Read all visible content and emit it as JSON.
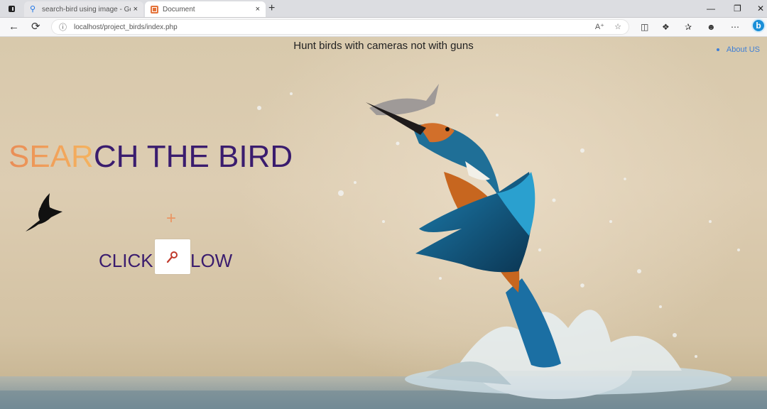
{
  "browser": {
    "tabs": [
      {
        "title": "search-bird using image - Google",
        "active": false
      },
      {
        "title": "Document",
        "active": true
      }
    ],
    "new_tab": "+",
    "close": "×",
    "address": "localhost/project_birds/index.php"
  },
  "page": {
    "tagline": "Hunt birds with cameras not with guns",
    "about_link": "About US",
    "headline_accent": "SEAR",
    "headline_rest": "CH THE BIRD",
    "plus": "+",
    "click_before": "CLICK",
    "click_after": "LOW"
  },
  "colors": {
    "headline_purple": "#3a1c6e",
    "accent_orange": "#f2a45b",
    "link_blue": "#3f7fd6"
  },
  "icons": [
    "tab-actions-icon",
    "search-icon",
    "document-icon",
    "back-icon",
    "reload-icon",
    "info-icon",
    "read-aloud-icon",
    "favorite-icon",
    "split-screen-icon",
    "extensions-icon",
    "favorites-bar-icon",
    "profile-icon",
    "more-icon",
    "bing-icon",
    "bird-silhouette-icon",
    "magnifier-icon"
  ]
}
